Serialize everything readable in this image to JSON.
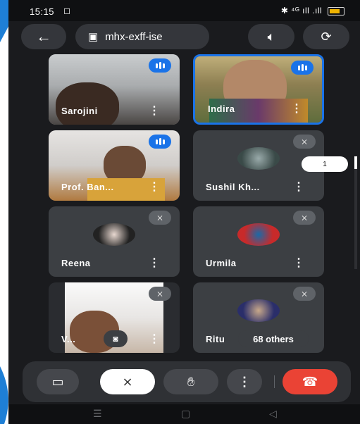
{
  "status_bar": {
    "time": "15:15",
    "right_icons": "✱ ⁴ᴳ ıll .ıll"
  },
  "top_bar": {
    "meeting_code": "mhx-exff-ise"
  },
  "participants": [
    {
      "name": "Sarojini",
      "mic": "speaking"
    },
    {
      "name": "Indira",
      "mic": "speaking"
    },
    {
      "name": "Prof. Ban...",
      "mic": "speaking"
    },
    {
      "name": "Sushil Kh...",
      "mic": "muted"
    },
    {
      "name": "Reena",
      "mic": "muted"
    },
    {
      "name": "Urmila",
      "mic": "muted"
    },
    {
      "name": "V...",
      "mic": "muted"
    },
    {
      "name": "Ritu",
      "mic": "muted"
    }
  ],
  "others_label": "68 others",
  "page_indicator": "1",
  "colors": {
    "background": "#1a1b1e",
    "tile": "#3c3f43",
    "accent": "#1a73e8",
    "hangup": "#ea4335"
  }
}
